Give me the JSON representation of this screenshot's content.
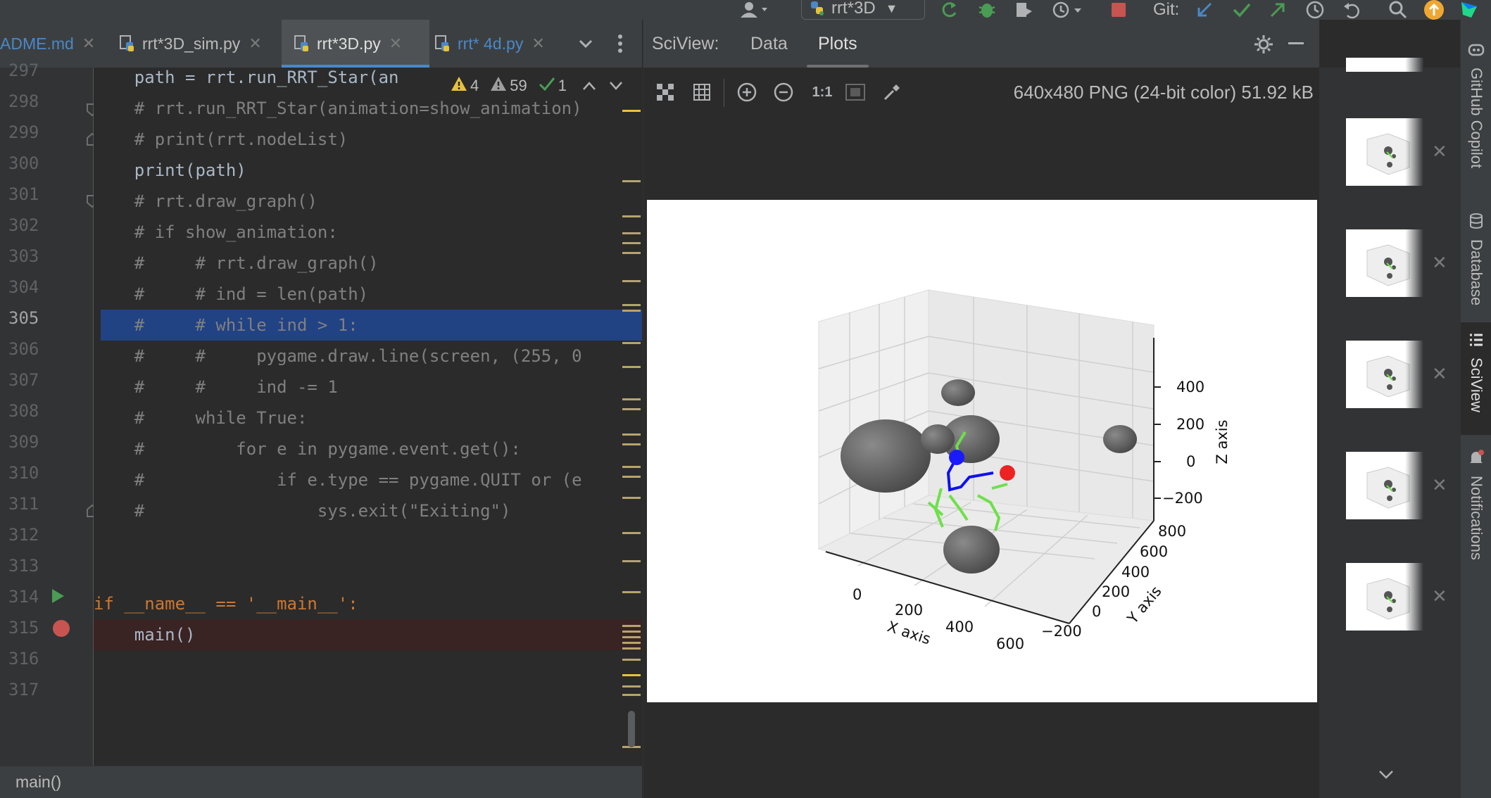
{
  "toolbar": {
    "run_config": "rrt*3D",
    "git_label": "Git:"
  },
  "tabs": [
    {
      "label": "ADME.md"
    },
    {
      "label": "rrt*3D_sim.py"
    },
    {
      "label": "rrt*3D.py"
    },
    {
      "label": "rrt* 4d.py"
    }
  ],
  "inspection": {
    "errors": "4",
    "warnings": "59",
    "ok": "1"
  },
  "editor": {
    "current_line": 305,
    "lines": [
      {
        "num": "297",
        "text": "    path = rrt.run_RRT_Star(an"
      },
      {
        "num": "298",
        "text": "    # rrt.run_RRT_Star(animation=show_animation)"
      },
      {
        "num": "299",
        "text": "    # print(rrt.nodeList)"
      },
      {
        "num": "300",
        "text": "    print(path)"
      },
      {
        "num": "301",
        "text": "    # rrt.draw_graph()"
      },
      {
        "num": "302",
        "text": "    # if show_animation:"
      },
      {
        "num": "303",
        "text": "    #     # rrt.draw_graph()"
      },
      {
        "num": "304",
        "text": "    #     # ind = len(path)"
      },
      {
        "num": "305",
        "text": "    #     # while ind > 1:"
      },
      {
        "num": "306",
        "text": "    #     #     pygame.draw.line(screen, (255, 0"
      },
      {
        "num": "307",
        "text": "    #     #     ind -= 1"
      },
      {
        "num": "308",
        "text": "    #     while True:"
      },
      {
        "num": "309",
        "text": "    #         for e in pygame.event.get():"
      },
      {
        "num": "310",
        "text": "    #             if e.type == pygame.QUIT or (e"
      },
      {
        "num": "311",
        "text": "    #                 sys.exit(\"Exiting\")"
      },
      {
        "num": "312",
        "text": ""
      },
      {
        "num": "313",
        "text": ""
      },
      {
        "num": "314",
        "text": "if __name__ == '__main__':"
      },
      {
        "num": "315",
        "text": "    main()"
      },
      {
        "num": "316",
        "text": ""
      },
      {
        "num": "317",
        "text": ""
      }
    ]
  },
  "breadcrumb": "main()",
  "sciview": {
    "title": "SciView:",
    "tabs": [
      "Data",
      "Plots"
    ],
    "active_tab": "Plots",
    "image_info": "640x480 PNG (24-bit color) 51.92 kB",
    "zoom_actual": "1:1"
  },
  "plot": {
    "x_label": "X axis",
    "y_label": "Y axis",
    "z_label": "Z axis",
    "x_ticks": [
      "0",
      "200",
      "400",
      "600"
    ],
    "y_ticks": [
      "800",
      "600",
      "400",
      "200",
      "0",
      "−200"
    ],
    "z_ticks": [
      "400",
      "200",
      "0",
      "−200"
    ]
  },
  "right_tools": [
    "GitHub Copilot",
    "Database",
    "SciView",
    "Notifications"
  ],
  "colors": {
    "accent": "#4a88c7",
    "selection": "#214283",
    "breakpoint": "#c75450",
    "run_green": "#499c54"
  }
}
